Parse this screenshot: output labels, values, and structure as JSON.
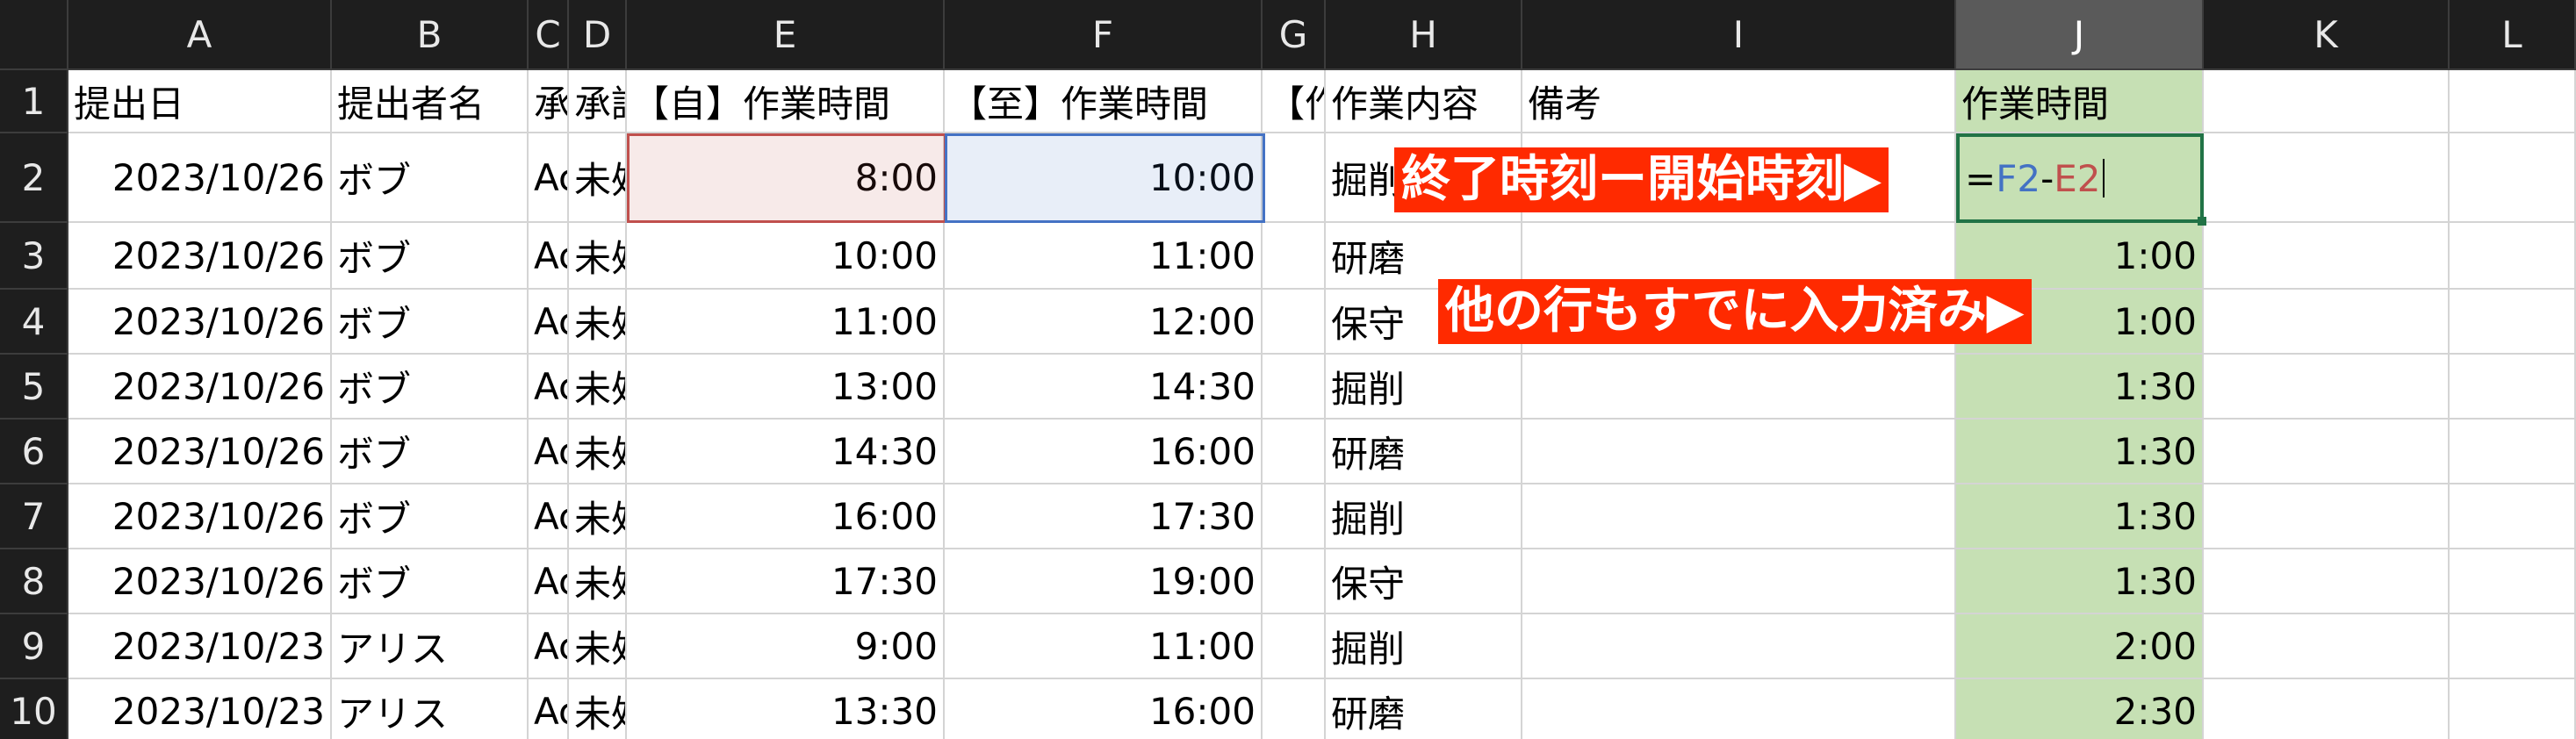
{
  "columns": [
    "A",
    "B",
    "C",
    "D",
    "E",
    "F",
    "G",
    "H",
    "I",
    "J",
    "K",
    "L"
  ],
  "selected_column": "J",
  "rows": [
    {
      "num": "1",
      "cells": {
        "A": "提出日",
        "B": "提出者名",
        "C": "承",
        "D": "承認",
        "E": "【自】作業時間",
        "F": "【至】作業時間",
        "G": "【作",
        "H": "作業内容",
        "I": "備考",
        "J": "作業時間",
        "K": "",
        "L": ""
      }
    },
    {
      "num": "2",
      "cells": {
        "A": "2023/10/26",
        "B": "ボブ",
        "C": "Ac",
        "D": "未処",
        "E": "8:00",
        "F": "10:00",
        "G": "",
        "H": "掘削",
        "I": "",
        "J": "",
        "K": "",
        "L": ""
      }
    },
    {
      "num": "3",
      "cells": {
        "A": "2023/10/26",
        "B": "ボブ",
        "C": "Ac",
        "D": "未処",
        "E": "10:00",
        "F": "11:00",
        "G": "",
        "H": "研磨",
        "I": "",
        "J": "1:00",
        "K": "",
        "L": ""
      }
    },
    {
      "num": "4",
      "cells": {
        "A": "2023/10/26",
        "B": "ボブ",
        "C": "Ac",
        "D": "未処",
        "E": "11:00",
        "F": "12:00",
        "G": "",
        "H": "保守",
        "I": "",
        "J": "1:00",
        "K": "",
        "L": ""
      }
    },
    {
      "num": "5",
      "cells": {
        "A": "2023/10/26",
        "B": "ボブ",
        "C": "Ac",
        "D": "未処",
        "E": "13:00",
        "F": "14:30",
        "G": "",
        "H": "掘削",
        "I": "",
        "J": "1:30",
        "K": "",
        "L": ""
      }
    },
    {
      "num": "6",
      "cells": {
        "A": "2023/10/26",
        "B": "ボブ",
        "C": "Ac",
        "D": "未処",
        "E": "14:30",
        "F": "16:00",
        "G": "",
        "H": "研磨",
        "I": "",
        "J": "1:30",
        "K": "",
        "L": ""
      }
    },
    {
      "num": "7",
      "cells": {
        "A": "2023/10/26",
        "B": "ボブ",
        "C": "Ac",
        "D": "未処",
        "E": "16:00",
        "F": "17:30",
        "G": "",
        "H": "掘削",
        "I": "",
        "J": "1:30",
        "K": "",
        "L": ""
      }
    },
    {
      "num": "8",
      "cells": {
        "A": "2023/10/26",
        "B": "ボブ",
        "C": "Ac",
        "D": "未処",
        "E": "17:30",
        "F": "19:00",
        "G": "",
        "H": "保守",
        "I": "",
        "J": "1:30",
        "K": "",
        "L": ""
      }
    },
    {
      "num": "9",
      "cells": {
        "A": "2023/10/23",
        "B": "アリス",
        "C": "Ac",
        "D": "未処",
        "E": "9:00",
        "F": "11:00",
        "G": "",
        "H": "掘削",
        "I": "",
        "J": "2:00",
        "K": "",
        "L": ""
      }
    },
    {
      "num": "10",
      "cells": {
        "A": "2023/10/23",
        "B": "アリス",
        "C": "Ac",
        "D": "未処",
        "E": "13:30",
        "F": "16:00",
        "G": "",
        "H": "研磨",
        "I": "",
        "J": "2:30",
        "K": "",
        "L": ""
      }
    }
  ],
  "formula": {
    "eq": "=",
    "ref1": "F2",
    "op": "-",
    "ref2": "E2"
  },
  "annotations": {
    "note1": "終了時刻ー開始時刻▶",
    "note2": "他の行もすでに入力済み▶"
  },
  "colors": {
    "header_bg": "#1e1e1e",
    "highlight_green": "#c6e0b4",
    "start_ref": "#c0504d",
    "end_ref": "#4472c4",
    "note_bg": "#ff2a00",
    "active_border": "#217346"
  }
}
